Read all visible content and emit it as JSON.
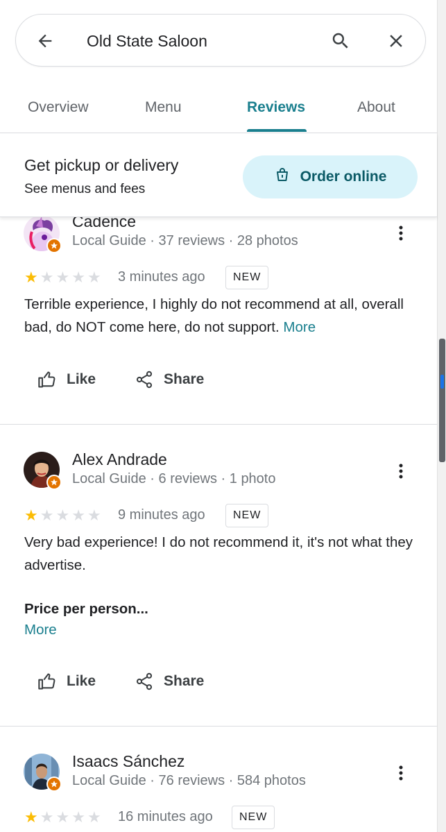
{
  "search": {
    "query": "Old State Saloon"
  },
  "tabs": [
    {
      "label": "Overview"
    },
    {
      "label": "Menu"
    },
    {
      "label": "Reviews"
    },
    {
      "label": "About"
    }
  ],
  "order": {
    "title": "Get pickup or delivery",
    "subtitle": "See menus and fees",
    "button_label": "Order online"
  },
  "reviews": [
    {
      "name": "Cadence",
      "meta": "Local Guide · 37 reviews · 28 photos",
      "rating": 1,
      "time": "3 minutes ago",
      "badge": "NEW",
      "text": "Terrible experience, I highly do not recommend at all, overall bad, do NOT come here, do not support.",
      "more": "More",
      "like": "Like",
      "share": "Share"
    },
    {
      "name": "Alex Andrade",
      "meta": "Local Guide · 6 reviews · 1 photo",
      "rating": 1,
      "time": "9 minutes ago",
      "badge": "NEW",
      "text": "Very bad experience! I do not recommend it, it's not what they advertise.",
      "price": "Price per person...",
      "more": "More",
      "like": "Like",
      "share": "Share"
    },
    {
      "name": "Isaacs Sánchez",
      "meta": "Local Guide · 76 reviews · 584 photos",
      "rating": 1,
      "time": "16 minutes ago",
      "badge": "NEW"
    }
  ],
  "colors": {
    "accent": "#1a7f8e",
    "star": "#fbbc04",
    "order_bg": "#d9f3fa",
    "guide_badge": "#e37400"
  }
}
